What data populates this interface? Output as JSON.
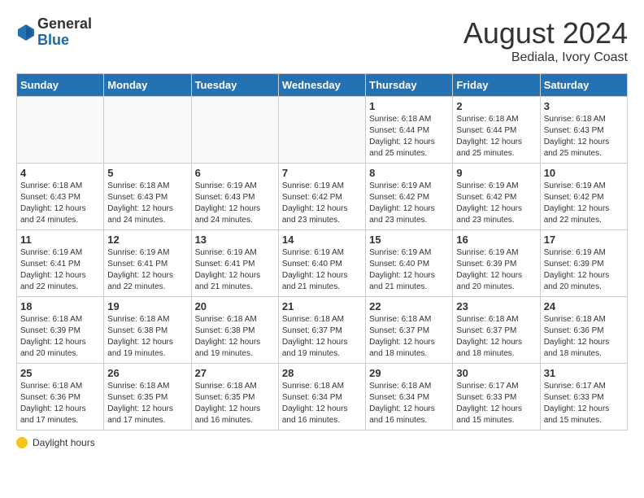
{
  "logo": {
    "general": "General",
    "blue": "Blue"
  },
  "title": {
    "month_year": "August 2024",
    "location": "Bediala, Ivory Coast"
  },
  "days_of_week": [
    "Sunday",
    "Monday",
    "Tuesday",
    "Wednesday",
    "Thursday",
    "Friday",
    "Saturday"
  ],
  "footer": {
    "label": "Daylight hours"
  },
  "weeks": [
    [
      {
        "day": "",
        "info": ""
      },
      {
        "day": "",
        "info": ""
      },
      {
        "day": "",
        "info": ""
      },
      {
        "day": "",
        "info": ""
      },
      {
        "day": "1",
        "info": "Sunrise: 6:18 AM\nSunset: 6:44 PM\nDaylight: 12 hours\nand 25 minutes."
      },
      {
        "day": "2",
        "info": "Sunrise: 6:18 AM\nSunset: 6:44 PM\nDaylight: 12 hours\nand 25 minutes."
      },
      {
        "day": "3",
        "info": "Sunrise: 6:18 AM\nSunset: 6:43 PM\nDaylight: 12 hours\nand 25 minutes."
      }
    ],
    [
      {
        "day": "4",
        "info": "Sunrise: 6:18 AM\nSunset: 6:43 PM\nDaylight: 12 hours\nand 24 minutes."
      },
      {
        "day": "5",
        "info": "Sunrise: 6:18 AM\nSunset: 6:43 PM\nDaylight: 12 hours\nand 24 minutes."
      },
      {
        "day": "6",
        "info": "Sunrise: 6:19 AM\nSunset: 6:43 PM\nDaylight: 12 hours\nand 24 minutes."
      },
      {
        "day": "7",
        "info": "Sunrise: 6:19 AM\nSunset: 6:42 PM\nDaylight: 12 hours\nand 23 minutes."
      },
      {
        "day": "8",
        "info": "Sunrise: 6:19 AM\nSunset: 6:42 PM\nDaylight: 12 hours\nand 23 minutes."
      },
      {
        "day": "9",
        "info": "Sunrise: 6:19 AM\nSunset: 6:42 PM\nDaylight: 12 hours\nand 23 minutes."
      },
      {
        "day": "10",
        "info": "Sunrise: 6:19 AM\nSunset: 6:42 PM\nDaylight: 12 hours\nand 22 minutes."
      }
    ],
    [
      {
        "day": "11",
        "info": "Sunrise: 6:19 AM\nSunset: 6:41 PM\nDaylight: 12 hours\nand 22 minutes."
      },
      {
        "day": "12",
        "info": "Sunrise: 6:19 AM\nSunset: 6:41 PM\nDaylight: 12 hours\nand 22 minutes."
      },
      {
        "day": "13",
        "info": "Sunrise: 6:19 AM\nSunset: 6:41 PM\nDaylight: 12 hours\nand 21 minutes."
      },
      {
        "day": "14",
        "info": "Sunrise: 6:19 AM\nSunset: 6:40 PM\nDaylight: 12 hours\nand 21 minutes."
      },
      {
        "day": "15",
        "info": "Sunrise: 6:19 AM\nSunset: 6:40 PM\nDaylight: 12 hours\nand 21 minutes."
      },
      {
        "day": "16",
        "info": "Sunrise: 6:19 AM\nSunset: 6:39 PM\nDaylight: 12 hours\nand 20 minutes."
      },
      {
        "day": "17",
        "info": "Sunrise: 6:19 AM\nSunset: 6:39 PM\nDaylight: 12 hours\nand 20 minutes."
      }
    ],
    [
      {
        "day": "18",
        "info": "Sunrise: 6:18 AM\nSunset: 6:39 PM\nDaylight: 12 hours\nand 20 minutes."
      },
      {
        "day": "19",
        "info": "Sunrise: 6:18 AM\nSunset: 6:38 PM\nDaylight: 12 hours\nand 19 minutes."
      },
      {
        "day": "20",
        "info": "Sunrise: 6:18 AM\nSunset: 6:38 PM\nDaylight: 12 hours\nand 19 minutes."
      },
      {
        "day": "21",
        "info": "Sunrise: 6:18 AM\nSunset: 6:37 PM\nDaylight: 12 hours\nand 19 minutes."
      },
      {
        "day": "22",
        "info": "Sunrise: 6:18 AM\nSunset: 6:37 PM\nDaylight: 12 hours\nand 18 minutes."
      },
      {
        "day": "23",
        "info": "Sunrise: 6:18 AM\nSunset: 6:37 PM\nDaylight: 12 hours\nand 18 minutes."
      },
      {
        "day": "24",
        "info": "Sunrise: 6:18 AM\nSunset: 6:36 PM\nDaylight: 12 hours\nand 18 minutes."
      }
    ],
    [
      {
        "day": "25",
        "info": "Sunrise: 6:18 AM\nSunset: 6:36 PM\nDaylight: 12 hours\nand 17 minutes."
      },
      {
        "day": "26",
        "info": "Sunrise: 6:18 AM\nSunset: 6:35 PM\nDaylight: 12 hours\nand 17 minutes."
      },
      {
        "day": "27",
        "info": "Sunrise: 6:18 AM\nSunset: 6:35 PM\nDaylight: 12 hours\nand 16 minutes."
      },
      {
        "day": "28",
        "info": "Sunrise: 6:18 AM\nSunset: 6:34 PM\nDaylight: 12 hours\nand 16 minutes."
      },
      {
        "day": "29",
        "info": "Sunrise: 6:18 AM\nSunset: 6:34 PM\nDaylight: 12 hours\nand 16 minutes."
      },
      {
        "day": "30",
        "info": "Sunrise: 6:17 AM\nSunset: 6:33 PM\nDaylight: 12 hours\nand 15 minutes."
      },
      {
        "day": "31",
        "info": "Sunrise: 6:17 AM\nSunset: 6:33 PM\nDaylight: 12 hours\nand 15 minutes."
      }
    ]
  ]
}
